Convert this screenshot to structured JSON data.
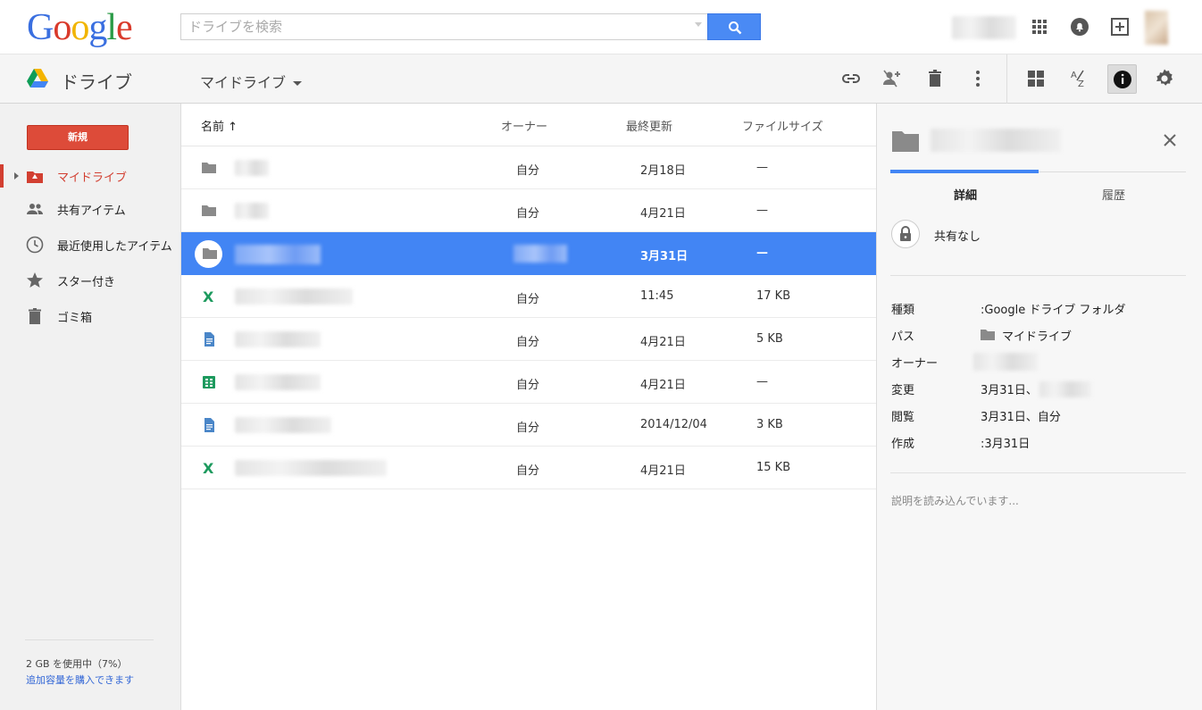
{
  "header": {
    "logo_letters": [
      "G",
      "o",
      "o",
      "g",
      "l",
      "e"
    ],
    "search_placeholder": "ドライブを検索"
  },
  "subbar": {
    "app_title": "ドライブ",
    "location_menu": "マイドライブ"
  },
  "sidebar": {
    "new_button": "新規",
    "items": [
      {
        "label": "マイドライブ",
        "icon": "my-drive-icon",
        "active": true
      },
      {
        "label": "共有アイテム",
        "icon": "shared-people-icon"
      },
      {
        "label": "最近使用したアイテム",
        "icon": "clock-icon"
      },
      {
        "label": "スター付き",
        "icon": "star-icon"
      },
      {
        "label": "ゴミ箱",
        "icon": "trash-icon"
      }
    ],
    "quota_text": "2 GB を使用中（7%）",
    "quota_link": "追加容量を購入できます"
  },
  "filelist": {
    "columns": {
      "name": "名前 ↑",
      "owner": "オーナー",
      "modified": "最終更新",
      "size": "ファイルサイズ"
    },
    "rows": [
      {
        "type": "folder",
        "owner": "自分",
        "modified": "2月18日",
        "size": "—"
      },
      {
        "type": "folder",
        "owner": "自分",
        "modified": "4月21日",
        "size": "—"
      },
      {
        "type": "folder",
        "owner": "",
        "modified": "3月31日",
        "size": "—",
        "selected": true
      },
      {
        "type": "excel",
        "owner": "自分",
        "modified": "11:45",
        "size": "17 KB"
      },
      {
        "type": "doc",
        "owner": "自分",
        "modified": "4月21日",
        "size": "5 KB"
      },
      {
        "type": "sheet",
        "owner": "自分",
        "modified": "4月21日",
        "size": "—"
      },
      {
        "type": "doc",
        "owner": "自分",
        "modified": "2014/12/04",
        "size": "3 KB"
      },
      {
        "type": "excel",
        "owner": "自分",
        "modified": "4月21日",
        "size": "15 KB"
      }
    ]
  },
  "details": {
    "tab_details": "詳細",
    "tab_activity": "履歴",
    "sharing": "共有なし",
    "props": [
      {
        "key": "種類",
        "value": ":Google ドライブ フォルダ"
      },
      {
        "key": "パス",
        "value": "マイドライブ"
      },
      {
        "key": "オーナー",
        "value": ""
      },
      {
        "key": "変更",
        "value": "3月31日、"
      },
      {
        "key": "閲覧",
        "value": "3月31日、自分"
      },
      {
        "key": "作成",
        "value": ":3月31日"
      }
    ],
    "description_loading": "説明を読み込んでいます..."
  },
  "colors": {
    "accent_blue": "#4285f4",
    "new_red": "#dd4b39",
    "active_red": "#d23f31"
  }
}
